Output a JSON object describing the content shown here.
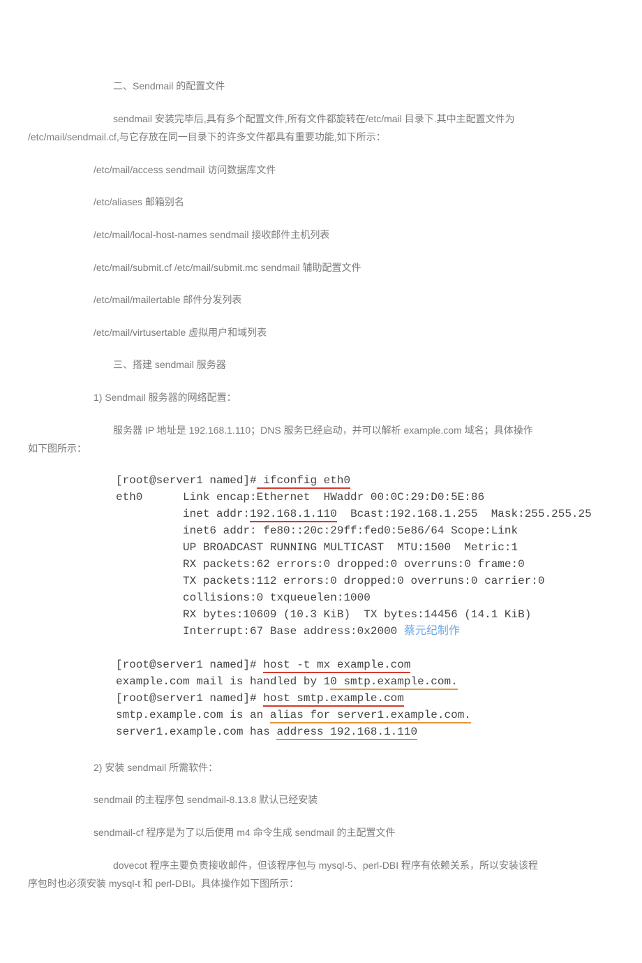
{
  "headings": {
    "h2": "二、Sendmail 的配置文件",
    "h3": "三、搭建 sendmail 服务器"
  },
  "para": {
    "intro1": "sendmail 安装完毕后,具有多个配置文件,所有文件都旋转在/etc/mail 目录下.其中主配置文件为",
    "intro2": "/etc/mail/sendmail.cf,与它存放在同一目录下的许多文件都具有重要功能,如下所示：",
    "cfg1": "/etc/mail/access sendmail 访问数据库文件",
    "cfg2": "/etc/aliases 邮箱别名",
    "cfg3": "/etc/mail/local-host-names sendmail 接收邮件主机列表",
    "cfg4": "/etc/mail/submit.cf  /etc/mail/submit.mc sendmail 辅助配置文件",
    "cfg5": "/etc/mail/mailertable 邮件分发列表",
    "cfg6": "/etc/mail/virtusertable 虚拟用户和域列表",
    "step1": "1) Sendmail 服务器的网络配置：",
    "net1": "服务器 IP 地址是 192.168.1.110；DNS 服务已经启动，并可以解析 example.com 域名；具体操作",
    "net2": "如下图所示：",
    "step2": "2) 安装 sendmail 所需软件：",
    "pkg1": "sendmail 的主程序包 sendmail-8.13.8 默认已经安装",
    "pkg2": "sendmail-cf 程序是为了以后使用 m4 命令生成 sendmail 的主配置文件",
    "dove1": "dovecot 程序主要负责接收邮件，但该程序包与 mysql-5、perl-DBI 程序有依赖关系，所以安装该程",
    "dove2": "序包时也必须安装 mysql-t 和 perl-DBI。具体操作如下图所示："
  },
  "term": {
    "l1a": "[root@server1 named]#",
    "l1b": " ifconfig eth0",
    "l2": "eth0      Link encap:Ethernet  HWaddr 00:0C:29:D0:5E:86",
    "l3a": "          inet addr:",
    "l3b": "192.168.1.110",
    "l3c": "  Bcast:192.168.1.255  Mask:255.255.25",
    "l4": "          inet6 addr: fe80::20c:29ff:fed0:5e86/64 Scope:Link",
    "l5": "          UP BROADCAST RUNNING MULTICAST  MTU:1500  Metric:1",
    "l6": "          RX packets:62 errors:0 dropped:0 overruns:0 frame:0",
    "l7": "          TX packets:112 errors:0 dropped:0 overruns:0 carrier:0",
    "l8": "          collisions:0 txqueuelen:1000",
    "l9": "          RX bytes:10609 (10.3 KiB)  TX bytes:14456 (14.1 KiB)",
    "l10a": "          Interrupt:67 Base address:0x2000 ",
    "l10b": "蔡元纪制作",
    "l12a": "[root@server1 named]# ",
    "l12b": "host -t mx example.com",
    "l13a": "example.com mail is handled by 1",
    "l13b": "0 smtp.example.com.",
    "l14a": "[root@server1 named]# ",
    "l14b": "host smtp.example.com",
    "l15a": "smtp.example.com is an ",
    "l15b": "alias for server1.example.com.",
    "l16a": "server1.example.com has ",
    "l16b": "address 192.168.1.110"
  }
}
